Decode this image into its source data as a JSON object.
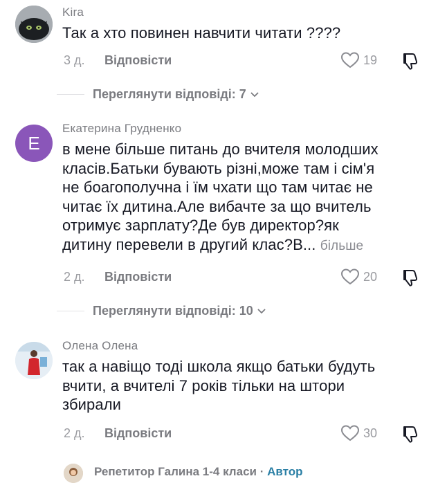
{
  "comments": [
    {
      "username": "Kira",
      "text": "Так а хто повинен навчити читати ????",
      "time": "3 д.",
      "reply_label": "Відповісти",
      "likes": "19",
      "view_replies": "Переглянути відповіді: 7",
      "avatar_icon": "dragon-avatar"
    },
    {
      "username": "Екатерина Грудненко",
      "avatar_letter": "E",
      "avatar_color": "#8a56b9",
      "text_lines": [
        "в мене більше питань до вчителя молодших",
        "класів.Батьки бувають різні,може там і сім'я",
        "не боагополучна і їм чхати що там читає не",
        "читає їх дитина.Але вибачте за що вчитель",
        "отримує зарплату?Де був директор?як",
        "дитину перевели в другий клас?В..."
      ],
      "more_label": "більше",
      "time": "2 д.",
      "reply_label": "Відповісти",
      "likes": "20",
      "view_replies": "Переглянути відповіді: 10"
    },
    {
      "username": "Олена Олена",
      "text_lines": [
        "так а навіщо тоді школа якщо батьки будуть",
        "вчити, а вчителі 7 років тільки на штори",
        "збирали"
      ],
      "time": "2 д.",
      "reply_label": "Відповісти",
      "likes": "30"
    }
  ],
  "reply_preview": {
    "username": "Репетитор Галина 1-4 класи",
    "separator": "·",
    "badge": "Автор"
  },
  "colors": {
    "author_badge": "#2a7fa5",
    "muted_text": "#7a7b80"
  }
}
